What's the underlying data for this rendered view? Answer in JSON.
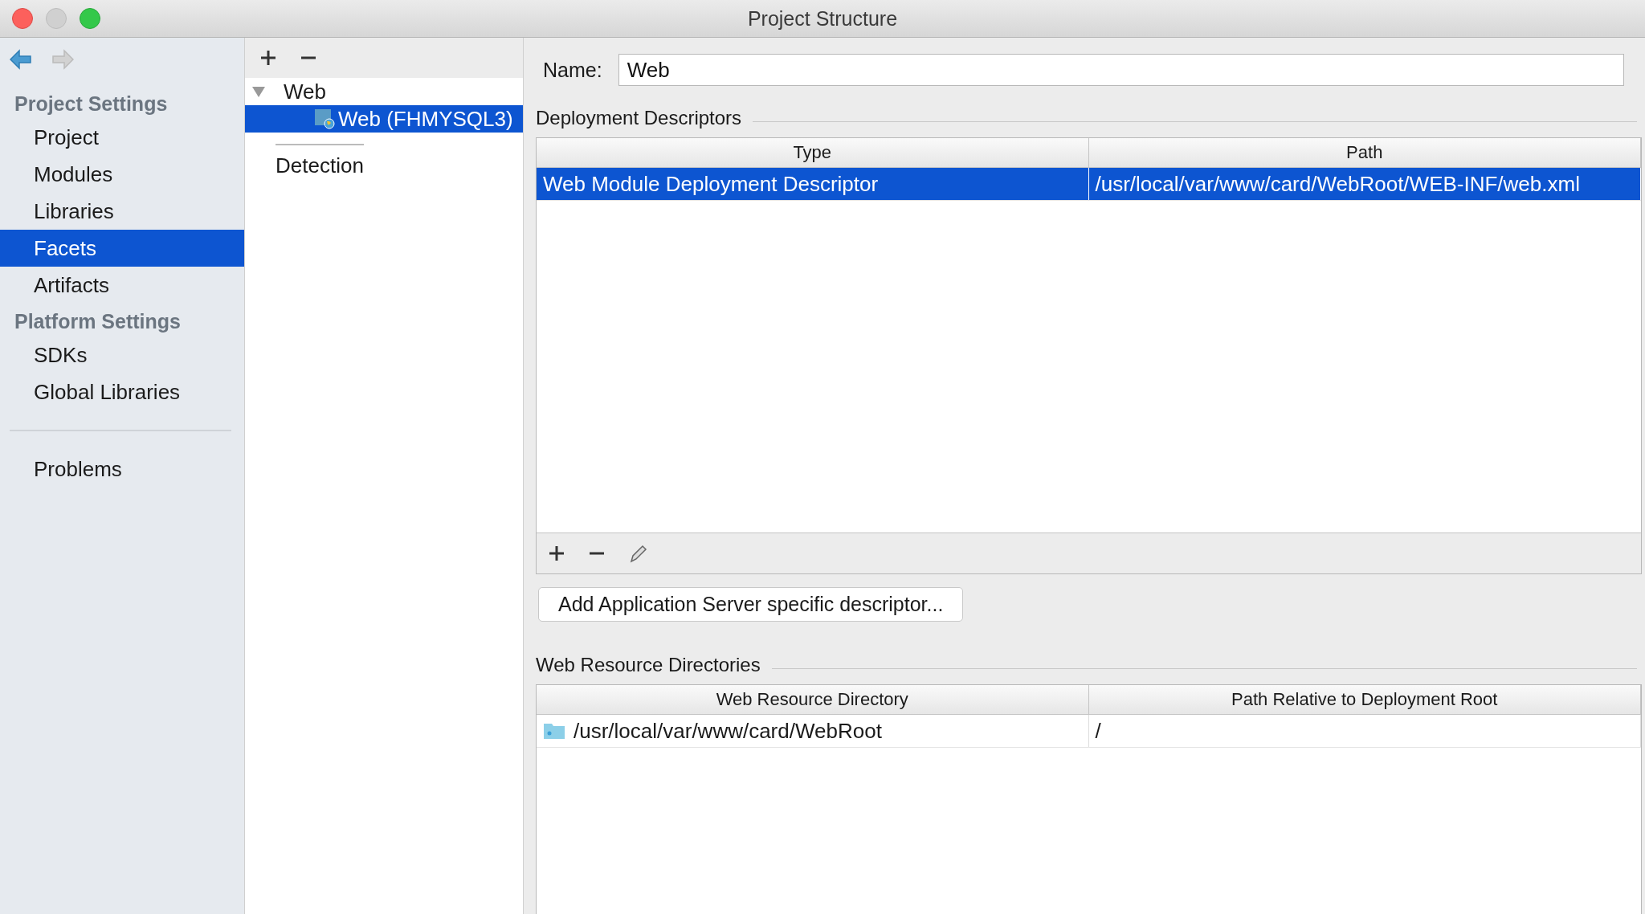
{
  "window": {
    "title": "Project Structure"
  },
  "sidebar": {
    "groups": [
      {
        "heading": "Project Settings",
        "items": [
          {
            "label": "Project",
            "selected": false
          },
          {
            "label": "Modules",
            "selected": false
          },
          {
            "label": "Libraries",
            "selected": false
          },
          {
            "label": "Facets",
            "selected": true
          },
          {
            "label": "Artifacts",
            "selected": false
          }
        ]
      },
      {
        "heading": "Platform Settings",
        "items": [
          {
            "label": "SDKs",
            "selected": false
          },
          {
            "label": "Global Libraries",
            "selected": false
          }
        ]
      }
    ],
    "footer_items": [
      {
        "label": "Problems",
        "selected": false
      }
    ]
  },
  "tree": {
    "nodes": [
      {
        "label": "Web",
        "expanded": true,
        "selected": false,
        "children": [
          {
            "label": "Web (FHMYSQL3)",
            "selected": true
          }
        ]
      }
    ],
    "detection": "Detection"
  },
  "name_field": {
    "label": "Name:",
    "value": "Web"
  },
  "deployment_descriptors": {
    "title": "Deployment Descriptors",
    "columns": [
      "Type",
      "Path"
    ],
    "rows": [
      {
        "cells": [
          "Web Module Deployment Descriptor",
          "/usr/local/var/www/card/WebRoot/WEB-INF/web.xml"
        ],
        "selected": true
      }
    ]
  },
  "add_server_descriptor_button": "Add Application Server specific descriptor...",
  "web_resource_directories": {
    "title": "Web Resource Directories",
    "columns": [
      "Web Resource Directory",
      "Path Relative to Deployment Root"
    ],
    "rows": [
      {
        "cells": [
          "/usr/local/var/www/card/WebRoot",
          "/"
        ],
        "selected": false
      }
    ]
  }
}
